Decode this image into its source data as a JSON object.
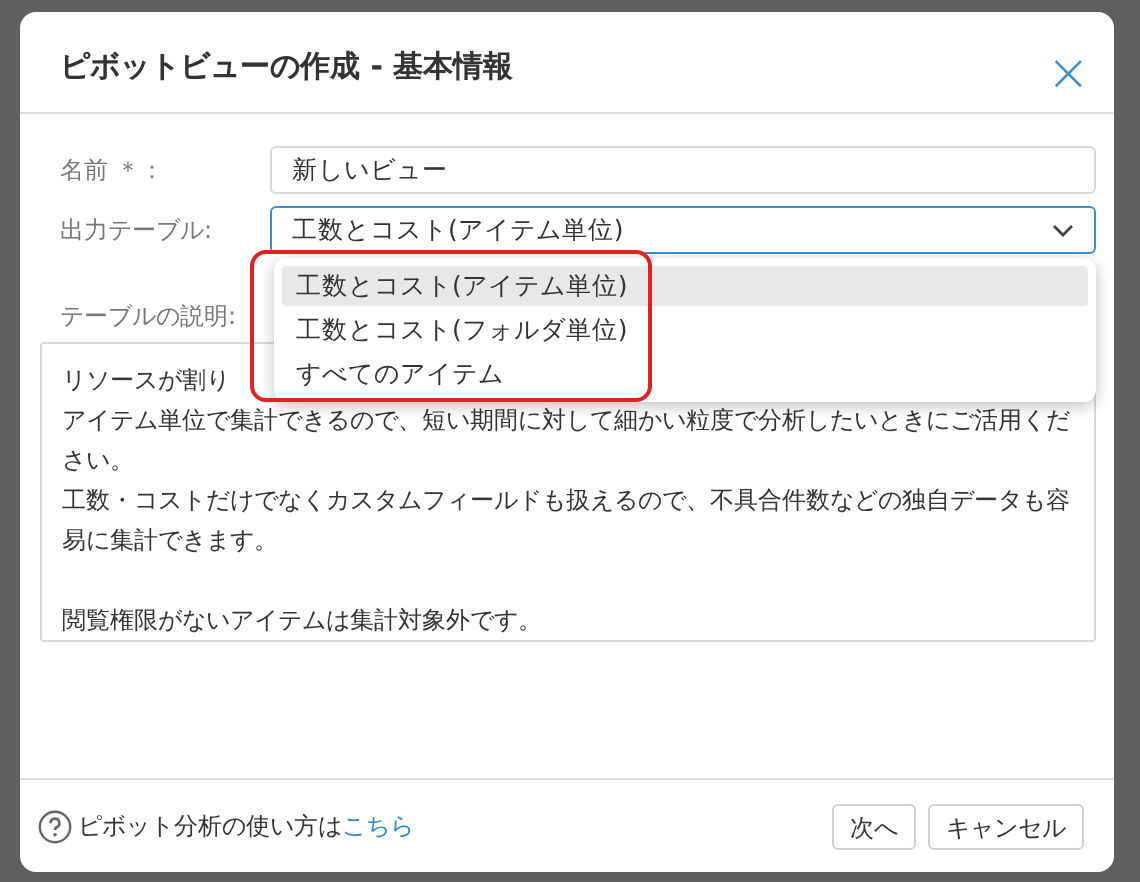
{
  "dialog": {
    "title": "ピボットビューの作成 - 基本情報",
    "close": "×",
    "fields": [
      {
        "label": "名前 ＊：",
        "value": "新しいビュー"
      },
      {
        "label": "出力テーブル:",
        "value": "工数とコスト(アイテム単位)",
        "expanded": true,
        "options": [
          {
            "label": "工数とコスト(アイテム単位)",
            "selected": true
          },
          {
            "label": "工数とコスト(フォルダ単位)",
            "selected": false
          },
          {
            "label": "すべてのアイテム",
            "selected": false
          }
        ]
      }
    ],
    "description": {
      "label": "テーブルの説明:",
      "blocks": [
        [
          "リソースが割り",
          "アイテム単位で集計できるので、短い期間に対して細かい粒度で分析したいときにご活用ください。",
          "工数・コストだけでなくカスタムフィールドも扱えるので、不具合件数などの独自データも容易に集計できます。"
        ],
        [
          "閲覧権限がないアイテムは集計対象外です。"
        ]
      ]
    },
    "footer": {
      "help_text": "ピボット分析の使い方は",
      "help_link": "こちら",
      "buttons": [
        "次へ",
        "キャンセル"
      ]
    }
  }
}
